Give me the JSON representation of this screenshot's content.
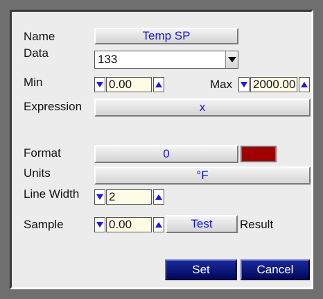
{
  "dialog": {
    "labels": {
      "name": "Name",
      "data": "Data",
      "min": "Min",
      "max": "Max",
      "expression": "Expression",
      "format": "Format",
      "units": "Units",
      "line_width": "Line Width",
      "sample": "Sample",
      "result": "Result"
    },
    "name_button": "Temp SP",
    "data_value": "133",
    "min_value": "0.00",
    "max_value": "2000.00",
    "expression_button": "x",
    "format_button": "0",
    "format_color": "#a00000",
    "units_button": "°F",
    "line_width_value": "2",
    "sample_value": "0.00",
    "test_button": "Test",
    "set_button": "Set",
    "cancel_button": "Cancel"
  },
  "colors": {
    "accent_text": "#1515d8",
    "nav_button": "#0b1678",
    "spin_arrow": "#1a1ae0"
  },
  "icons": {
    "spin_down": "triangle-down-icon",
    "spin_up": "triangle-up-icon",
    "dropdown": "chevron-down-icon"
  }
}
